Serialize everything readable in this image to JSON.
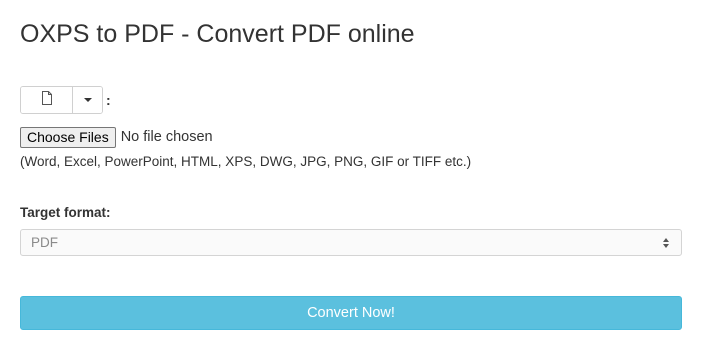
{
  "page": {
    "title": "OXPS to PDF - Convert PDF online"
  },
  "source_selector": {
    "icon": "file-icon",
    "dropdown_icon": "caret-down-icon",
    "colon": ":"
  },
  "file_input": {
    "button_label": "Choose Files",
    "status_text": "No file chosen"
  },
  "formats_hint": "(Word, Excel, PowerPoint, HTML, XPS, DWG, JPG, PNG, GIF or TIFF etc.)",
  "target_format": {
    "label": "Target format:",
    "selected": "PDF"
  },
  "convert_button": {
    "label": "Convert Now!",
    "color": "#5bc0de"
  }
}
